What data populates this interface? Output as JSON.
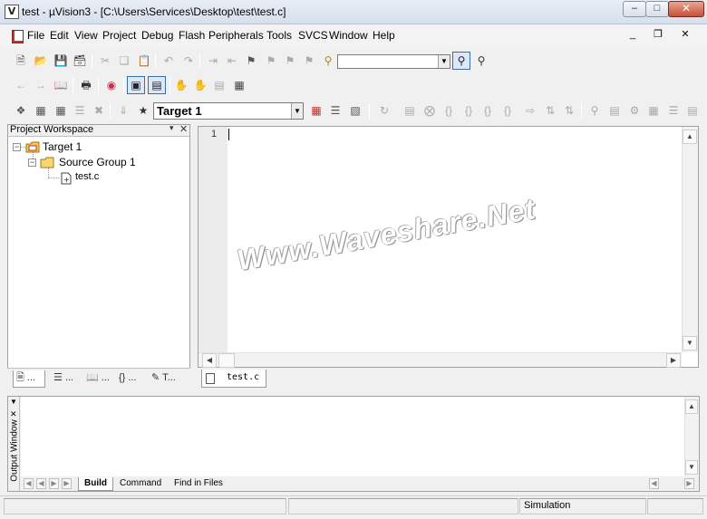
{
  "window": {
    "title": "test  - µVision3 - [C:\\Users\\Services\\Desktop\\test\\test.c]",
    "app_icon_glyph": "V",
    "controls": {
      "minimize": "–",
      "maximize": "□",
      "close": "✕"
    }
  },
  "menu": {
    "items": [
      "File",
      "Edit",
      "View",
      "Project",
      "Debug",
      "Flash",
      "Peripherals",
      "Tools",
      "SVCS",
      "Window",
      "Help"
    ],
    "mdi_controls": {
      "minimize": "_",
      "restore": "❐",
      "close": "✕"
    }
  },
  "toolbar": {
    "find_combo_value": "",
    "combo_arrow": "▼"
  },
  "build_toolbar": {
    "target_value": "Target 1"
  },
  "project_workspace": {
    "title": "Project Workspace",
    "pin_glyph": "▾",
    "close_glyph": "✕",
    "tree": {
      "root_label": "Target 1",
      "group_label": "Source Group 1",
      "file_label": "test.c",
      "expand_glyph": "−"
    },
    "tabs": [
      {
        "label": "...",
        "icon": "files-tab-icon"
      },
      {
        "label": "...",
        "icon": "regs-tab-icon"
      },
      {
        "label": "...",
        "icon": "books-tab-icon"
      },
      {
        "label": "...",
        "icon": "functions-tab-icon"
      },
      {
        "label": "T...",
        "icon": "templates-tab-icon"
      }
    ]
  },
  "editor": {
    "line_numbers": [
      "1"
    ],
    "watermark": "Www.Waveshare.Net",
    "tab_label": "test.c"
  },
  "output": {
    "side_label": "Output Window",
    "tabs": [
      "Build",
      "Command",
      "Find in Files"
    ],
    "active_tab": "Build"
  },
  "status": {
    "mode": "Simulation"
  }
}
